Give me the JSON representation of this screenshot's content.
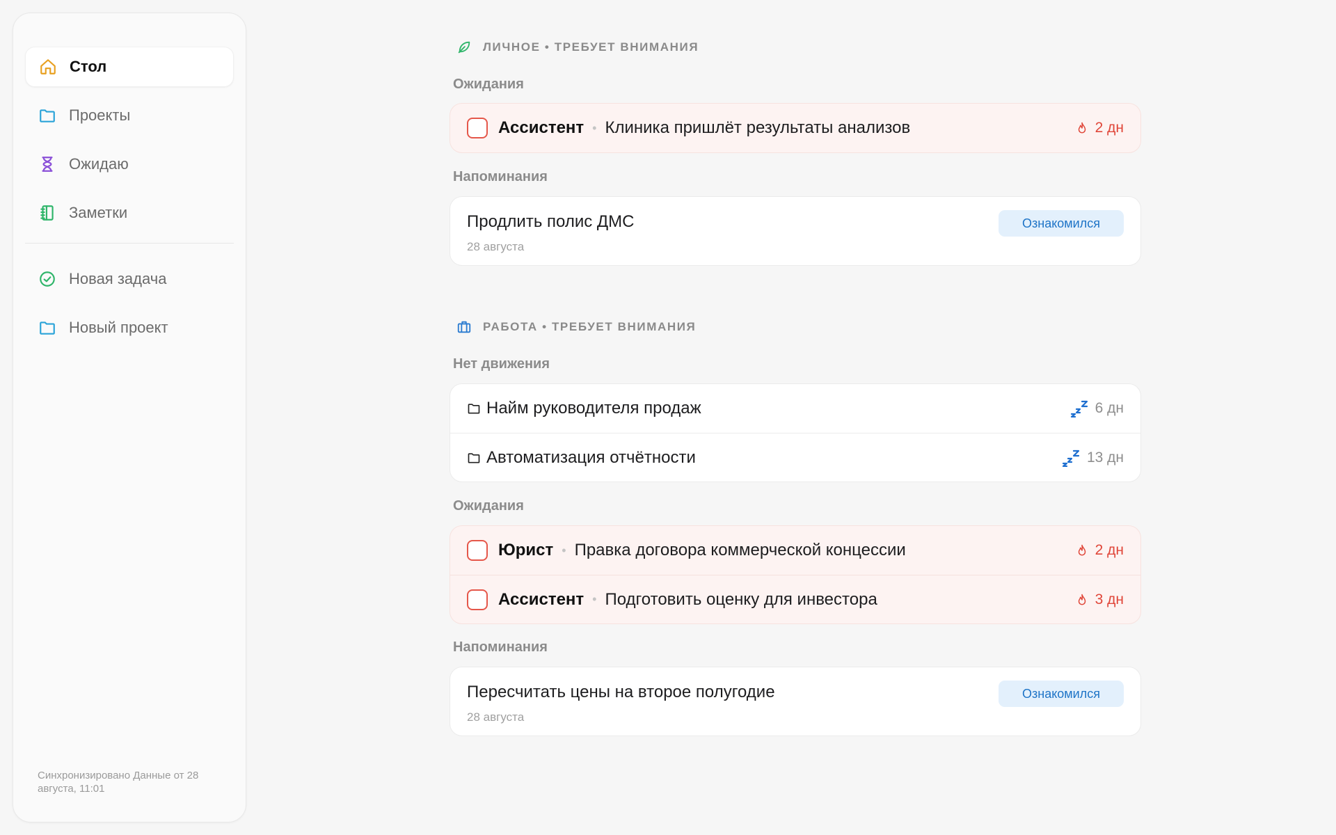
{
  "sidebar": {
    "nav": [
      {
        "label": "Стол",
        "icon": "home-icon",
        "active": true,
        "color": "#e8a020"
      },
      {
        "label": "Проекты",
        "icon": "folder-icon",
        "active": false,
        "color": "#2aa3d8"
      },
      {
        "label": "Ожидаю",
        "icon": "hourglass-icon",
        "active": false,
        "color": "#8a4fd8"
      },
      {
        "label": "Заметки",
        "icon": "notebook-icon",
        "active": false,
        "color": "#2fb56a"
      }
    ],
    "actions": [
      {
        "label": "Новая задача",
        "icon": "check-circle-icon",
        "color": "#2fb56a"
      },
      {
        "label": "Новый проект",
        "icon": "folder-icon",
        "color": "#2aa3d8"
      }
    ],
    "sync": "Синхронизировано Данные от 28 августа, 11:01"
  },
  "personal": {
    "title": "Личное • Требует внимания",
    "icon": "leaf-icon",
    "waiting_label": "Ожидания",
    "waiting": [
      {
        "who": "Ассистент",
        "text": "Клиника пришлёт результаты анализов",
        "age": "2 дн"
      }
    ],
    "reminders_label": "Напоминания",
    "reminders": [
      {
        "title": "Продлить полис ДМС",
        "date": "28 августа",
        "button": "Ознакомился"
      }
    ]
  },
  "work": {
    "title": "Работа • Требует внимания",
    "icon": "briefcase-icon",
    "stalled_label": "Нет движения",
    "stalled": [
      {
        "name": "Найм руководителя продаж",
        "age": "6 дн"
      },
      {
        "name": "Автоматизация отчётности",
        "age": "13 дн"
      }
    ],
    "waiting_label": "Ожидания",
    "waiting": [
      {
        "who": "Юрист",
        "text": "Правка договора коммерческой концессии",
        "age": "2 дн"
      },
      {
        "who": "Ассистент",
        "text": "Подготовить оценку для инвестора",
        "age": "3 дн"
      }
    ],
    "reminders_label": "Напоминания",
    "reminders": [
      {
        "title": "Пересчитать цены на второе полугодие",
        "date": "28 августа",
        "button": "Ознакомился"
      }
    ]
  },
  "colors": {
    "alert": "#e0473a",
    "accent_blue": "#1e74c7",
    "sleep_blue": "#1e6fd0"
  }
}
